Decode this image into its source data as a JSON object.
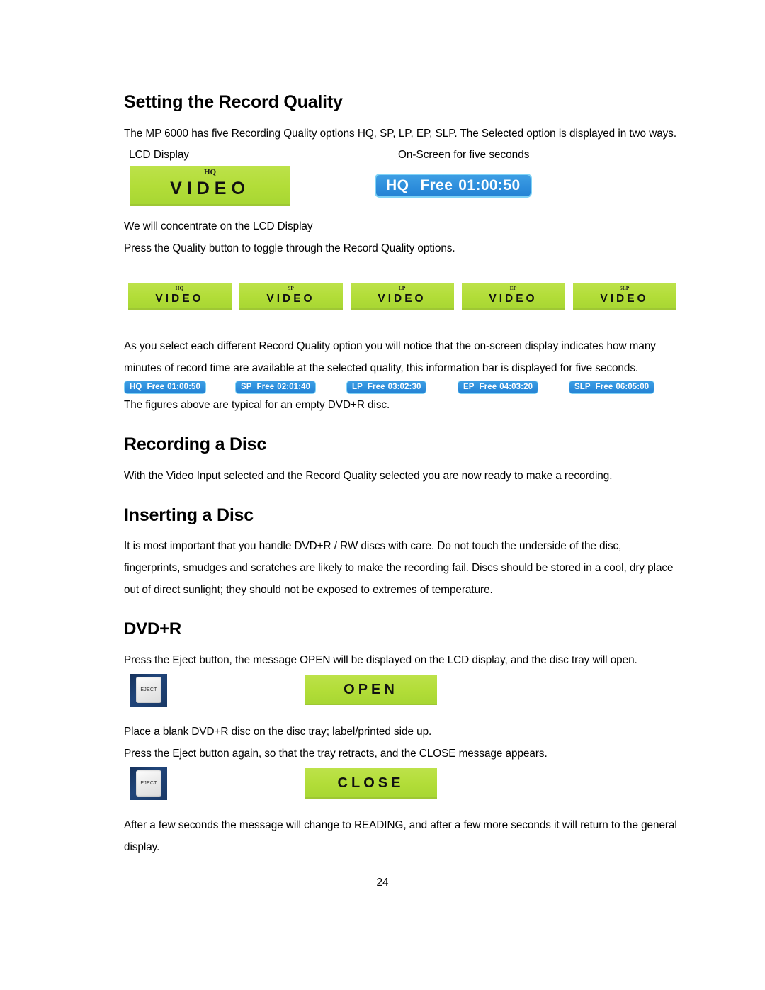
{
  "page": {
    "number": "24"
  },
  "sections": {
    "record_quality": {
      "heading": "Setting the Record Quality",
      "intro": "The MP 6000 has five Recording Quality options HQ, SP, LP, EP, SLP. The Selected option is displayed in two ways.",
      "caption_lcd": "LCD Display",
      "caption_onscreen": "On-Screen for five seconds",
      "lcd_example": {
        "mode": "HQ",
        "word": "VIDEO"
      },
      "osd_example": {
        "mode": "HQ",
        "free_label": "Free",
        "time": "01:00:50"
      },
      "note_concentrate": "We will concentrate on the LCD Display",
      "note_toggle": "Press the Quality button to toggle through the Record Quality options.",
      "lcd_panels": [
        {
          "mode": "HQ",
          "word": "VIDEO"
        },
        {
          "mode": "SP",
          "word": "VIDEO"
        },
        {
          "mode": "LP",
          "word": "VIDEO"
        },
        {
          "mode": "EP",
          "word": "VIDEO"
        },
        {
          "mode": "SLP",
          "word": "VIDEO"
        }
      ],
      "explanation": "As you select each different Record Quality option you will notice that the on-screen display indicates how many minutes of record time are available at the selected quality, this information bar is displayed for five seconds.",
      "osd_bars": [
        {
          "mode": "HQ",
          "free_label": "Free",
          "time": "01:00:50"
        },
        {
          "mode": "SP",
          "free_label": "Free",
          "time": "02:01:40"
        },
        {
          "mode": "LP",
          "free_label": "Free",
          "time": "03:02:30"
        },
        {
          "mode": "EP",
          "free_label": "Free",
          "time": "04:03:20"
        },
        {
          "mode": "SLP",
          "free_label": "Free",
          "time": "06:05:00"
        }
      ],
      "figures_note": "The figures above are typical for an empty DVD+R disc."
    },
    "recording_a_disc": {
      "heading": "Recording a Disc",
      "text": "With the Video Input selected and the Record Quality selected you are now ready to make a recording."
    },
    "inserting_a_disc": {
      "heading": "Inserting a Disc",
      "text": "It is most important that you handle DVD+R / RW discs with care. Do not touch the underside of the disc, fingerprints, smudges and scratches are likely to make the recording fail. Discs should be stored in a cool, dry place out of direct sunlight; they should not be exposed to extremes of temperature."
    },
    "dvd_plus_r": {
      "heading": "DVD+R",
      "press_eject": "Press the Eject button, the message OPEN will be displayed on the LCD display, and the disc tray will open.",
      "eject_button_label": "EJECT",
      "open_message": "OPEN",
      "place_disc": "Place a blank DVD+R disc on the disc tray; label/printed side up.",
      "press_eject_again": "Press the Eject button again, so that the tray retracts, and the CLOSE message appears.",
      "close_message": "CLOSE",
      "after_seconds": "After a few seconds the message will change to READING, and after a few more seconds it will return to the general display."
    }
  },
  "colors": {
    "lcd_green": "#b2dd38",
    "osd_blue": "#2d8ddb",
    "osd_border": "#7fd2f5",
    "eject_frame": "#1a3966"
  }
}
